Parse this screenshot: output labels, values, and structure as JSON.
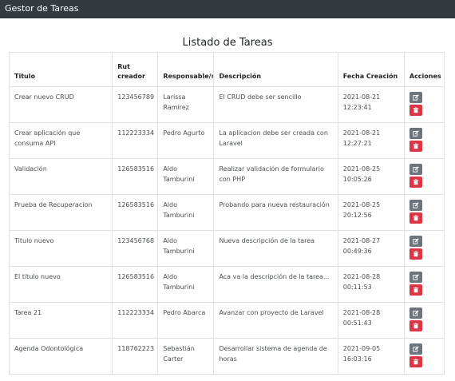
{
  "navbar": {
    "brand": "Gestor de Tareas"
  },
  "page": {
    "title": "Listado de Tareas"
  },
  "table": {
    "headers": {
      "title": "Titulo",
      "rut": "Rut creador",
      "responsible": "Responsable/s",
      "description": "Descripción",
      "date": "Fecha Creación",
      "actions": "Acciones"
    },
    "rows": [
      {
        "title": "Crear nuevo CRUD",
        "rut": "123456789",
        "responsible": "Larissa Ramirez",
        "description": "El CRUD debe ser sencillo",
        "date": "2021-08-21",
        "time": "12:23:41"
      },
      {
        "title": "Crear aplicación que consuma API",
        "rut": "112223334",
        "responsible": "Pedro Agurto",
        "description": "La aplicacion debe ser creada con Laravel",
        "date": "2021-08-21",
        "time": "12:27:21"
      },
      {
        "title": "Validación",
        "rut": "126583516",
        "responsible": "Aldo Tamburini",
        "description": "Realizar validación de formulario con PHP",
        "date": "2021-08-25",
        "time": "10:05:26"
      },
      {
        "title": "Prueba de Recuperacion",
        "rut": "126583516",
        "responsible": "Aldo Tamburini",
        "description": "Probando para nueva restauración",
        "date": "2021-08-25",
        "time": "20:12:56"
      },
      {
        "title": "Titulo nuevo",
        "rut": "123456768",
        "responsible": "Aldo Tamburini",
        "description": "Nueva descripción de la tarea",
        "date": "2021-08-27",
        "time": "00:49:36"
      },
      {
        "title": "El titulo nuevo",
        "rut": "126583516",
        "responsible": "Aldo Tamburini",
        "description": "Aca va la descripción de la tarea...",
        "date": "2021-08-28",
        "time": "00:11:53"
      },
      {
        "title": "Tarea 21",
        "rut": "112223334",
        "responsible": "Pedro Abarca",
        "description": "Avanzar con proyecto de Laravel",
        "date": "2021-08-28",
        "time": "00:51:43"
      },
      {
        "title": "Agenda Odontológica",
        "rut": "118762223",
        "responsible": "Sebastián Carter",
        "description": "Desarrollar sistema de agenda de horas",
        "date": "2021-09-05",
        "time": "16:03:16"
      }
    ]
  },
  "icons": {
    "edit": "edit-icon",
    "delete": "trash-icon"
  },
  "colors": {
    "navbar": "#343a40",
    "edit_button": "#6c757d",
    "delete_button": "#dc3545"
  }
}
